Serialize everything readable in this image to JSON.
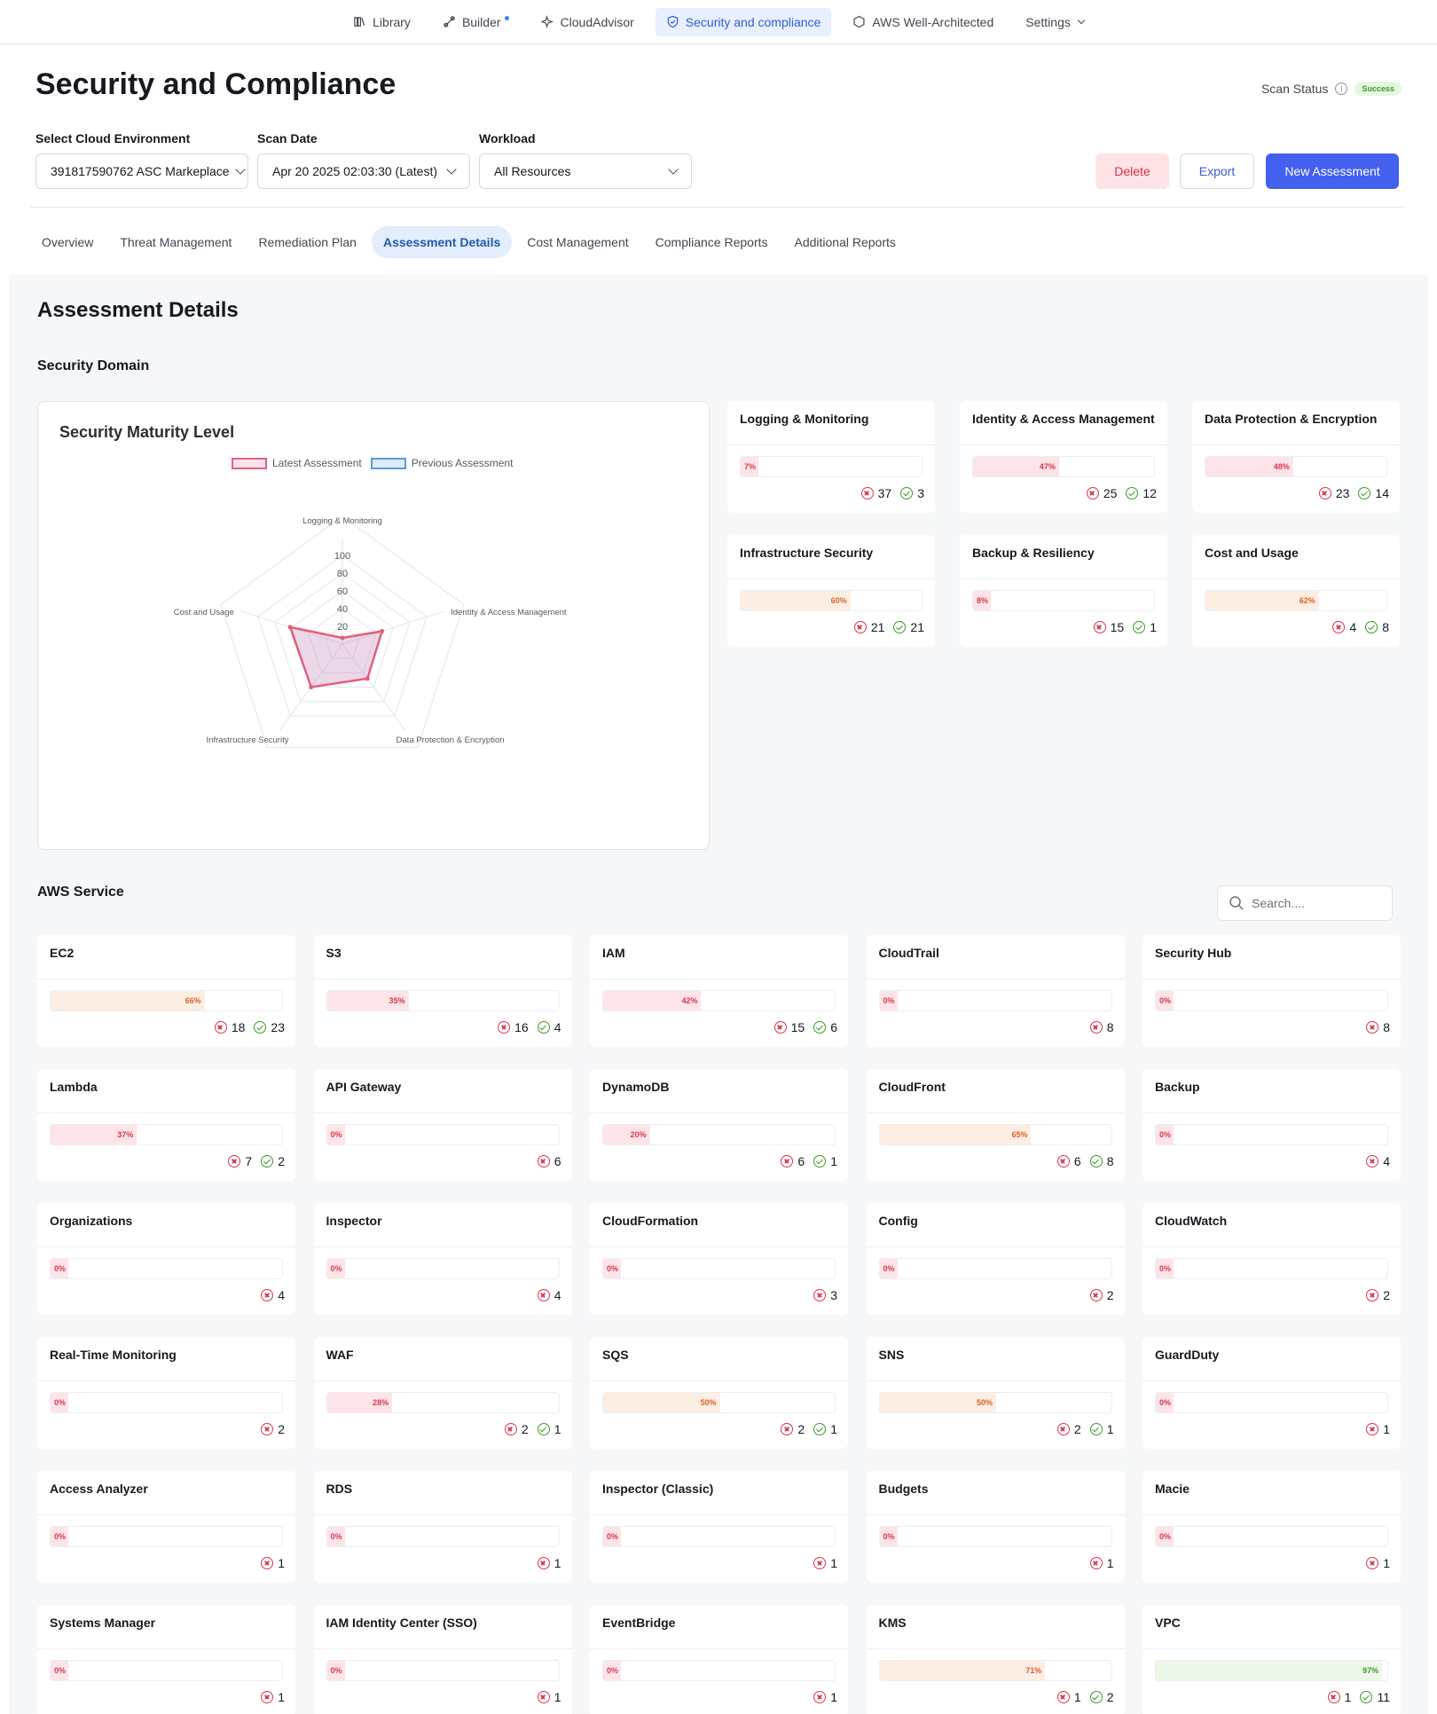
{
  "nav": [
    {
      "label": "Library",
      "icon": "library-icon",
      "active": false
    },
    {
      "label": "Builder",
      "icon": "builder-icon",
      "active": false,
      "dot": true
    },
    {
      "label": "CloudAdvisor",
      "icon": "sparkle-icon",
      "active": false
    },
    {
      "label": "Security and compliance",
      "icon": "shield-icon",
      "active": true
    },
    {
      "label": "AWS Well-Architected",
      "icon": "hexagon-icon",
      "active": false
    },
    {
      "label": "Settings",
      "icon": "chevron-down-icon",
      "active": false
    }
  ],
  "header": {
    "title": "Security and Compliance",
    "scan_status_label": "Scan Status",
    "scan_status_value": "Success"
  },
  "filters": {
    "cloud_env_label": "Select Cloud Environment",
    "cloud_env_value": "391817590762 ASC Markeplace",
    "scan_date_label": "Scan Date",
    "scan_date_value": "Apr 20 2025 02:03:30 (Latest)",
    "workload_label": "Workload",
    "workload_value": "All Resources"
  },
  "actions": {
    "delete": "Delete",
    "export": "Export",
    "new_assessment": "New Assessment"
  },
  "tabs": [
    "Overview",
    "Threat Management",
    "Remediation Plan",
    "Assessment Details",
    "Cost Management",
    "Compliance Reports",
    "Additional Reports"
  ],
  "active_tab": 3,
  "main": {
    "title": "Assessment Details",
    "security_domain_title": "Security Domain",
    "aws_service_title": "AWS Service",
    "search_placeholder": "Search...."
  },
  "chart_data": {
    "type": "radar",
    "title": "Security Maturity Level",
    "axes": [
      "Logging & Monitoring",
      "Identity & Access Management",
      "Data Protection & Encryption",
      "Infrastructure Security",
      "Cost and Usage"
    ],
    "ticks": [
      "20",
      "40",
      "60",
      "80",
      "100"
    ],
    "range": [
      0,
      100
    ],
    "series": [
      {
        "name": "Latest Assessment",
        "values": [
          7,
          47,
          48,
          60,
          62
        ],
        "color": "#e0607e"
      },
      {
        "name": "Previous Assessment",
        "values": [],
        "color": "#5b9bd5"
      }
    ],
    "legend_position": "top"
  },
  "domains": [
    {
      "name": "Logging & Monitoring",
      "pct": 7,
      "fail": "37",
      "pass": "3"
    },
    {
      "name": "Identity & Access Management",
      "pct": 47,
      "fail": "25",
      "pass": "12"
    },
    {
      "name": "Data Protection & Encryption",
      "pct": 48,
      "fail": "23",
      "pass": "14"
    },
    {
      "name": "Infrastructure Security",
      "pct": 60,
      "fail": "21",
      "pass": "21"
    },
    {
      "name": "Backup & Resiliency",
      "pct": 8,
      "fail": "15",
      "pass": "1"
    },
    {
      "name": "Cost and Usage",
      "pct": 62,
      "fail": "4",
      "pass": "8"
    }
  ],
  "services": [
    {
      "name": "EC2",
      "pct": 66,
      "fail": "18",
      "pass": "23"
    },
    {
      "name": "S3",
      "pct": 35,
      "fail": "16",
      "pass": "4"
    },
    {
      "name": "IAM",
      "pct": 42,
      "fail": "15",
      "pass": "6"
    },
    {
      "name": "CloudTrail",
      "pct": 0,
      "fail": "8",
      "pass": null
    },
    {
      "name": "Security Hub",
      "pct": 0,
      "fail": "8",
      "pass": null
    },
    {
      "name": "Lambda",
      "pct": 37,
      "fail": "7",
      "pass": "2"
    },
    {
      "name": "API Gateway",
      "pct": 0,
      "fail": "6",
      "pass": null
    },
    {
      "name": "DynamoDB",
      "pct": 20,
      "fail": "6",
      "pass": "1"
    },
    {
      "name": "CloudFront",
      "pct": 65,
      "fail": "6",
      "pass": "8"
    },
    {
      "name": "Backup",
      "pct": 0,
      "fail": "4",
      "pass": null
    },
    {
      "name": "Organizations",
      "pct": 0,
      "fail": "4",
      "pass": null
    },
    {
      "name": "Inspector",
      "pct": 0,
      "fail": "4",
      "pass": null
    },
    {
      "name": "CloudFormation",
      "pct": 0,
      "fail": "3",
      "pass": null
    },
    {
      "name": "Config",
      "pct": 0,
      "fail": "2",
      "pass": null
    },
    {
      "name": "CloudWatch",
      "pct": 0,
      "fail": "2",
      "pass": null
    },
    {
      "name": "Real-Time Monitoring",
      "pct": 0,
      "fail": "2",
      "pass": null
    },
    {
      "name": "WAF",
      "pct": 28,
      "fail": "2",
      "pass": "1"
    },
    {
      "name": "SQS",
      "pct": 50,
      "fail": "2",
      "pass": "1"
    },
    {
      "name": "SNS",
      "pct": 50,
      "fail": "2",
      "pass": "1"
    },
    {
      "name": "GuardDuty",
      "pct": 0,
      "fail": "1",
      "pass": null
    },
    {
      "name": "Access Analyzer",
      "pct": 0,
      "fail": "1",
      "pass": null
    },
    {
      "name": "RDS",
      "pct": 0,
      "fail": "1",
      "pass": null
    },
    {
      "name": "Inspector (Classic)",
      "pct": 0,
      "fail": "1",
      "pass": null
    },
    {
      "name": "Budgets",
      "pct": 0,
      "fail": "1",
      "pass": null
    },
    {
      "name": "Macie",
      "pct": 0,
      "fail": "1",
      "pass": null
    },
    {
      "name": "Systems Manager",
      "pct": 0,
      "fail": "1",
      "pass": null
    },
    {
      "name": "IAM Identity Center (SSO)",
      "pct": 0,
      "fail": "1",
      "pass": null
    },
    {
      "name": "EventBridge",
      "pct": 0,
      "fail": "1",
      "pass": null
    },
    {
      "name": "KMS",
      "pct": 71,
      "fail": "1",
      "pass": "2"
    },
    {
      "name": "VPC",
      "pct": 97,
      "fail": "1",
      "pass": "11"
    }
  ]
}
